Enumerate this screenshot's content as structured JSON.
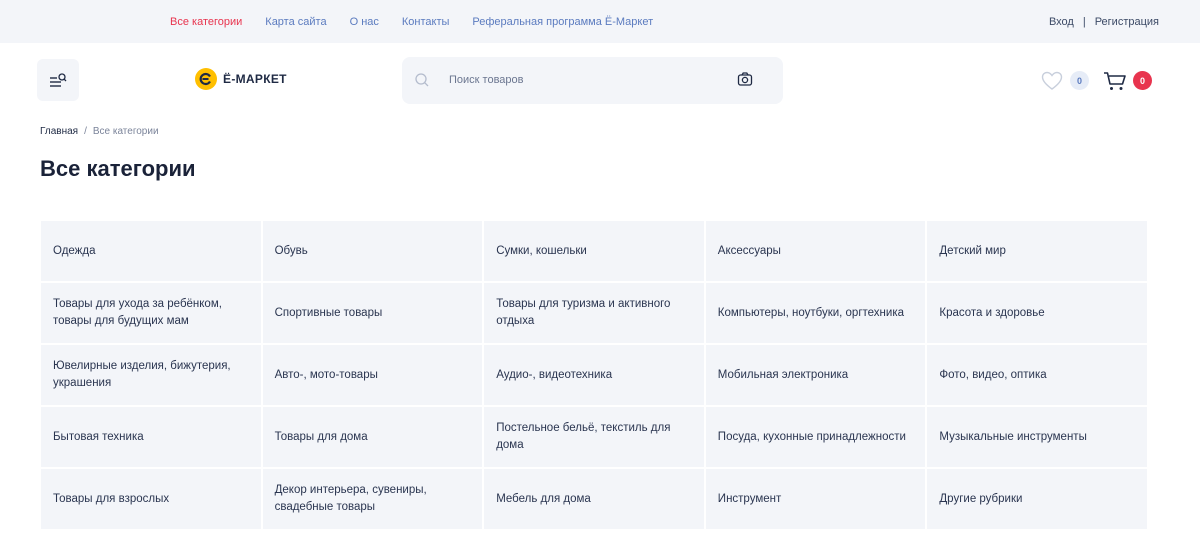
{
  "topnav": {
    "links": [
      "Все категории",
      "Карта сайта",
      "О нас",
      "Контакты",
      "Реферальная программа Ё-Маркет"
    ],
    "active_index": 0
  },
  "auth": {
    "login": "Вход",
    "separator": "|",
    "register": "Регистрация"
  },
  "logo": {
    "letter": "Є",
    "text": "Ё-МАРКЕТ"
  },
  "search": {
    "placeholder": "Поиск товаров",
    "value": ""
  },
  "header": {
    "favorites_count": "0",
    "cart_count": "0"
  },
  "breadcrumb": {
    "home": "Главная",
    "separator": "/",
    "current": "Все категории"
  },
  "page": {
    "title": "Все категории"
  },
  "categories": [
    "Одежда",
    "Обувь",
    "Сумки, кошельки",
    "Аксессуары",
    "Детский мир",
    "Товары для ухода за ребёнком, товары для будущих мам",
    "Спортивные товары",
    "Товары для туризма и активного отдыха",
    "Компьютеры, ноутбуки, оргтехника",
    "Красота и здоровье",
    "Ювелирные изделия, бижутерия, украшения",
    "Авто-, мото-товары",
    "Аудио-, видеотехника",
    "Мобильная электроника",
    "Фото, видео, оптика",
    "Бытовая техника",
    "Товары для дома",
    "Постельное бельё, текстиль для дома",
    "Посуда, кухонные принадлежности",
    "Музыкальные инструменты",
    "Товары для взрослых",
    "Декор интерьера, сувениры, свадебные товары",
    "Мебель для дома",
    "Инструмент",
    "Другие рубрики"
  ],
  "colors": {
    "accent_red": "#e8344e",
    "link_blue": "#5b7bbf",
    "panel_bg": "#f3f5f9",
    "logo_yellow": "#ffbf00"
  }
}
